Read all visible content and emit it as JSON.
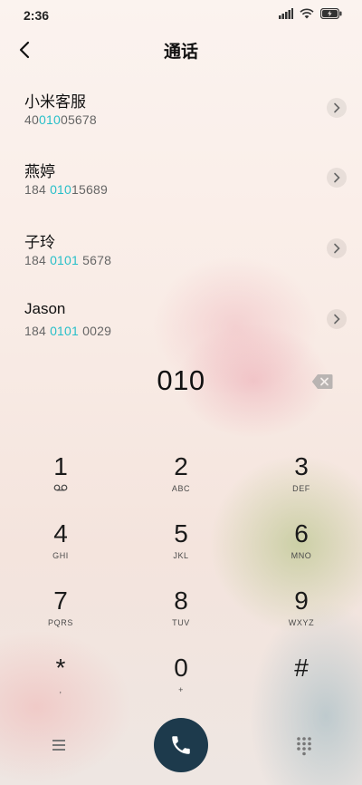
{
  "status_bar": {
    "time": "2:36"
  },
  "nav": {
    "title": "通话"
  },
  "results": [
    {
      "name": "小米客服",
      "num_pre": "40",
      "num_hl": "010",
      "num_post": "05678"
    },
    {
      "name": "燕婷",
      "num_pre": "184 ",
      "num_hl": "010",
      "num_post": "15689"
    },
    {
      "name": "子玲",
      "num_pre": "184 ",
      "num_hl": "0101",
      "num_post": " 5678"
    },
    {
      "name": "Jason",
      "num_pre": "184 ",
      "num_hl": "0101",
      "num_post": " 0029"
    }
  ],
  "dial": {
    "digits": "010"
  },
  "keypad": [
    {
      "digit": "1",
      "letters": ""
    },
    {
      "digit": "2",
      "letters": "ABC"
    },
    {
      "digit": "3",
      "letters": "DEF"
    },
    {
      "digit": "4",
      "letters": "GHI"
    },
    {
      "digit": "5",
      "letters": "JKL"
    },
    {
      "digit": "6",
      "letters": "MNO"
    },
    {
      "digit": "7",
      "letters": "PQRS"
    },
    {
      "digit": "8",
      "letters": "TUV"
    },
    {
      "digit": "9",
      "letters": "WXYZ"
    },
    {
      "digit": "*",
      "letters": ","
    },
    {
      "digit": "0",
      "letters": "+"
    },
    {
      "digit": "#",
      "letters": ""
    }
  ],
  "colors": {
    "highlight": "#27bfc9",
    "call_button": "#1d3a4c"
  }
}
